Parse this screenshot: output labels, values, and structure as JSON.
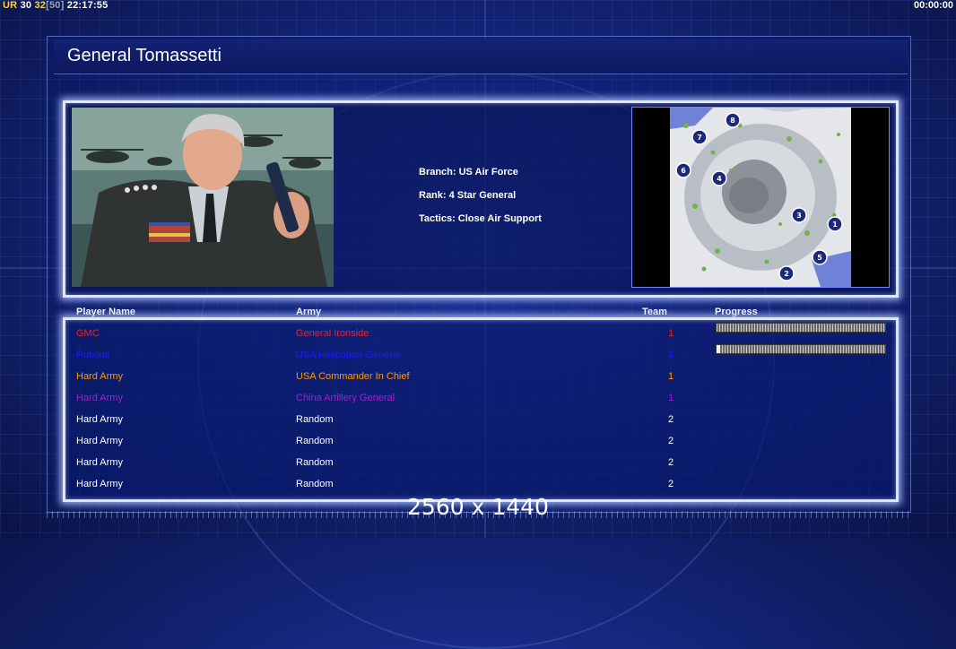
{
  "hud": {
    "prefix": "UR",
    "fps_current": "30",
    "fps_limit_a": "32",
    "fps_limit_b": "[50]",
    "clock": "22:17:55",
    "timer": "00:00:00"
  },
  "general": {
    "title": "General Tomassetti",
    "branch": "Branch: US Air Force",
    "rank": "Rank: 4 Star General",
    "tactics": "Tactics: Close Air Support"
  },
  "map": {
    "start_positions": [
      "1",
      "2",
      "3",
      "4",
      "5",
      "6",
      "7",
      "8"
    ]
  },
  "players_table": {
    "headers": {
      "player_name": "Player Name",
      "army": "Army",
      "team": "Team",
      "progress": "Progress"
    },
    "rows": [
      {
        "name": "GMC",
        "army": "General Ironside",
        "team": "1",
        "color": "#ff1a1a",
        "progress": 1.0
      },
      {
        "name": "Rubsdit",
        "army": "USA Helicopter General",
        "team": "1",
        "color": "#1a1aff",
        "progress": 0.02
      },
      {
        "name": "Hard Army",
        "army": "USA Commander In Chief",
        "team": "1",
        "color": "#ff9a00",
        "progress": null
      },
      {
        "name": "Hard Army",
        "army": "China Artillery General",
        "team": "1",
        "color": "#a020d0",
        "progress": null
      },
      {
        "name": "Hard Army",
        "army": "Random",
        "team": "2",
        "color": "#ffffff",
        "progress": null
      },
      {
        "name": "Hard Army",
        "army": "Random",
        "team": "2",
        "color": "#ffffff",
        "progress": null
      },
      {
        "name": "Hard Army",
        "army": "Random",
        "team": "2",
        "color": "#ffffff",
        "progress": null
      },
      {
        "name": "Hard Army",
        "army": "Random",
        "team": "2",
        "color": "#ffffff",
        "progress": null
      }
    ]
  },
  "resolution_label": "2560 x 1440"
}
